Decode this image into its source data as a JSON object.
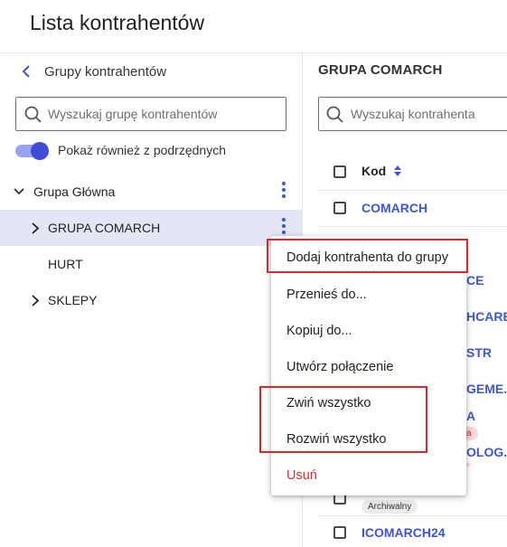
{
  "page": {
    "title": "Lista kontrahentów"
  },
  "left_panel": {
    "back_label": "Grupy kontrahentów",
    "search_placeholder": "Wyszukaj grupę kontrahentów",
    "toggle_label": "Pokaż również z podrzędnych",
    "toggle_on": true,
    "tree": [
      {
        "label": "Grupa Główna",
        "expanded": true
      },
      {
        "label": "GRUPA COMARCH",
        "selected": true,
        "expandable": true
      },
      {
        "label": "HURT"
      },
      {
        "label": "SKLEPY",
        "expandable": true
      }
    ]
  },
  "right_panel": {
    "title": "GRUPA COMARCH",
    "search_placeholder": "Wyszukaj kontrahenta",
    "column_header": "Kod",
    "rows": [
      {
        "code": "COMARCH"
      },
      {
        "code": "CE"
      },
      {
        "code": "HCARE"
      },
      {
        "code": "STR"
      },
      {
        "code": "GEME..."
      },
      {
        "code": "A",
        "badge": "a"
      },
      {
        "code": "OLOG..."
      },
      {
        "badge": "Archiwalny"
      },
      {
        "code": "ICOMARCH24"
      }
    ]
  },
  "context_menu": {
    "items": [
      "Dodaj kontrahenta do grupy",
      "Przenieś do...",
      "Kopiuj do...",
      "Utwórz połączenie",
      "Zwiń wszystko",
      "Rozwiń wszystko"
    ],
    "danger_item": "Usuń"
  },
  "colors": {
    "accent": "#3e55d5",
    "selected_row": "#e4e6f5",
    "danger": "#d32f3b",
    "highlight_box": "#d9272e"
  }
}
